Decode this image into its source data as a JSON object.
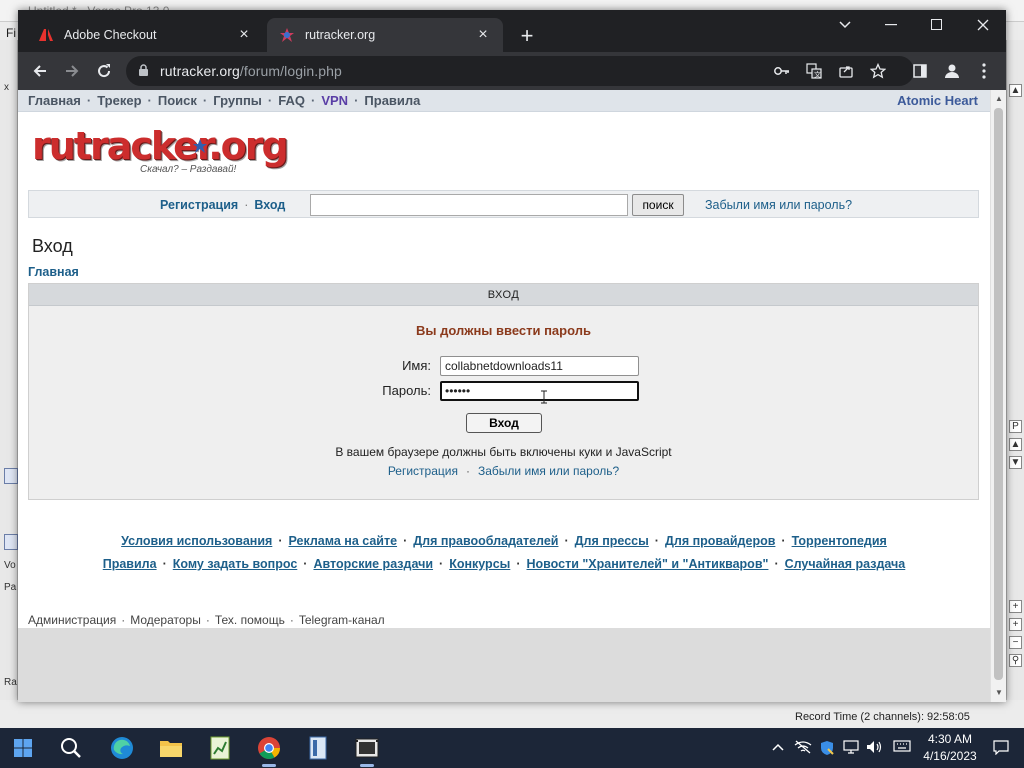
{
  "background_app": {
    "title": "Untitled * - Vegas Pro 13.0",
    "menu_first": "Fi",
    "left_labels": [
      "x",
      "Vo",
      "Pa",
      "Ra"
    ],
    "status": "Record Time (2 channels): 92:58:05"
  },
  "browser": {
    "tabs": [
      {
        "label": "Adobe Checkout",
        "icon": "adobe-icon",
        "active": false
      },
      {
        "label": "rutracker.org",
        "icon": "rutracker-favicon",
        "active": true
      }
    ],
    "url_host": "rutracker.org",
    "url_path": "/forum/login.php"
  },
  "site": {
    "nav": {
      "links": [
        "Главная",
        "Трекер",
        "Поиск",
        "Группы",
        "FAQ",
        "VPN",
        "Правила"
      ],
      "right_link": "Atomic Heart"
    },
    "logo": {
      "text_main": "rutracker",
      "text_org": ".org",
      "tagline": "Скачал? – Раздавай!"
    },
    "searchbar": {
      "register": "Регистрация",
      "login": "Вход",
      "search_button": "поиск",
      "forgot": "Забыли имя или пароль?"
    },
    "page_title": "Вход",
    "breadcrumb": "Главная",
    "login_box": {
      "header": "ВХОД",
      "warning": "Вы должны ввести пароль",
      "username_label": "Имя:",
      "username_value": "collabnetdownloads11",
      "password_label": "Пароль:",
      "password_value": "••••••",
      "submit": "Вход",
      "note": "В вашем браузере должны быть включены куки и JavaScript",
      "register": "Регистрация",
      "forgot": "Забыли имя или пароль?"
    },
    "footer_row1": [
      "Условия использования",
      "Реклама на сайте",
      "Для правообладателей",
      "Для прессы",
      "Для провайдеров",
      "Торрентопедия"
    ],
    "footer_row2": [
      "Правила",
      "Кому задать вопрос",
      "Авторские раздачи",
      "Конкурсы",
      "Новости \"Хранителей\" и \"Антикваров\"",
      "Случайная раздача"
    ],
    "footer_row3": [
      "Администрация",
      "Модераторы",
      "Тех. помощь",
      "Telegram-канал"
    ]
  },
  "taskbar": {
    "time": "4:30 AM",
    "date": "4/16/2023"
  },
  "colors": {
    "link": "#1d5f8a",
    "warning": "#8b3a1c",
    "chrome_dark": "#202124",
    "chrome_toolbar": "#35363a",
    "taskbar": "#1c2638"
  }
}
